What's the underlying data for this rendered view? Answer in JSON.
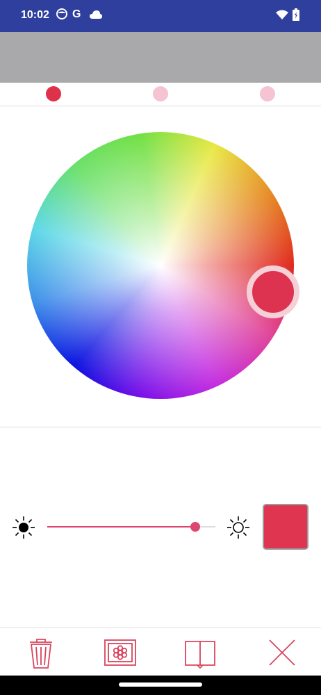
{
  "status_bar": {
    "time": "10:02",
    "left_icons": [
      "face-icon",
      "google-icon",
      "cloud-icon"
    ],
    "right_icons": [
      "wifi-icon",
      "battery-icon"
    ]
  },
  "page_indicator": {
    "dots": [
      {
        "active": true,
        "color": "#e0314a"
      },
      {
        "active": false,
        "color": "#f5c3d2"
      },
      {
        "active": false,
        "color": "#f5c3d2"
      }
    ]
  },
  "color_wheel": {
    "selected_color": "#dd3350",
    "handle_ring_color": "#f6d0d7"
  },
  "brightness": {
    "level": 0.88,
    "accent": "#dd4670",
    "min_icon": "sun-dark-icon",
    "max_icon": "sun-light-icon"
  },
  "preview_swatch": {
    "color": "#df3550"
  },
  "toolbar": {
    "icon_color": "#d9445e",
    "items": [
      "trash-icon",
      "picture-frame-icon",
      "book-icon",
      "close-icon"
    ]
  }
}
